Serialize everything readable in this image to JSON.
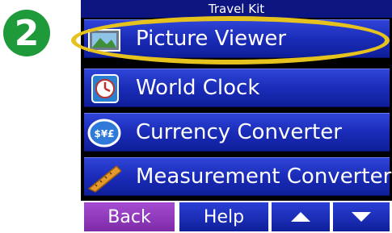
{
  "step_badge": {
    "number": "2",
    "color": "#1f9a3a"
  },
  "title": "Travel Kit",
  "menu": [
    {
      "label": "Picture Viewer",
      "icon": "picture-icon"
    },
    {
      "label": "World Clock",
      "icon": "clock-icon"
    },
    {
      "label": "Currency Converter",
      "icon": "currency-icon"
    },
    {
      "label": "Measurement Converter",
      "icon": "tape-measure-icon"
    }
  ],
  "highlight": {
    "target": "Picture Viewer",
    "color": "#e6c21e"
  },
  "bottom": {
    "back_label": "Back",
    "help_label": "Help",
    "up_icon": "arrow-up-icon",
    "down_icon": "arrow-down-icon"
  },
  "colors": {
    "title_bar": "#0c1580",
    "menu_button": "#1a2cb8",
    "back_button": "#8a34b8",
    "highlight_ring": "#e6c21e"
  }
}
